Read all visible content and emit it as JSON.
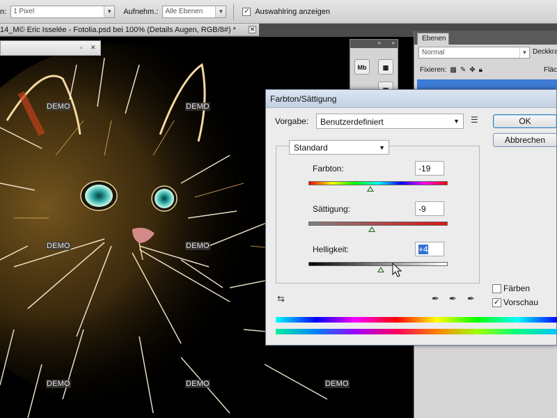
{
  "options_bar": {
    "size_label_tail": "n:",
    "size_value": "1 Pixel",
    "sample_label": "Aufnehm.:",
    "sample_value": "Alle Ebenen",
    "show_ring_label": "Auswahlring anzeigen",
    "show_ring_checked": "✓"
  },
  "document": {
    "tab_title": "14_M© Eric Isselée - Fotolia.psd bei 100% (Details Augen, RGB/8#) *",
    "close_glyph": "✕",
    "watermark": "DEMO"
  },
  "layers_panel": {
    "tab": "Ebenen",
    "blend_mode": "Normal",
    "opacity_label": "Deckkra",
    "lock_label": "Fixieren:",
    "fill_label": "Fläch"
  },
  "mini_panel": {
    "mb_label": "Mb"
  },
  "dialog": {
    "title": "Farbton/Sättigung",
    "preset_label": "Vorgabe:",
    "preset_value": "Benutzerdefiniert",
    "ok_label": "OK",
    "cancel_label": "Abbrechen",
    "channel_value": "Standard",
    "hue_label": "Farbton:",
    "hue_value": "-19",
    "hue_slider_value": -19,
    "saturation_label": "Sättigung:",
    "saturation_value": "-9",
    "saturation_slider_value": -9,
    "lightness_label": "Helligkeit:",
    "lightness_value": "+4",
    "lightness_slider_value": 4,
    "colorize_label": "Färben",
    "colorize_checked": "",
    "preview_label": "Vorschau",
    "preview_checked": "✓"
  }
}
